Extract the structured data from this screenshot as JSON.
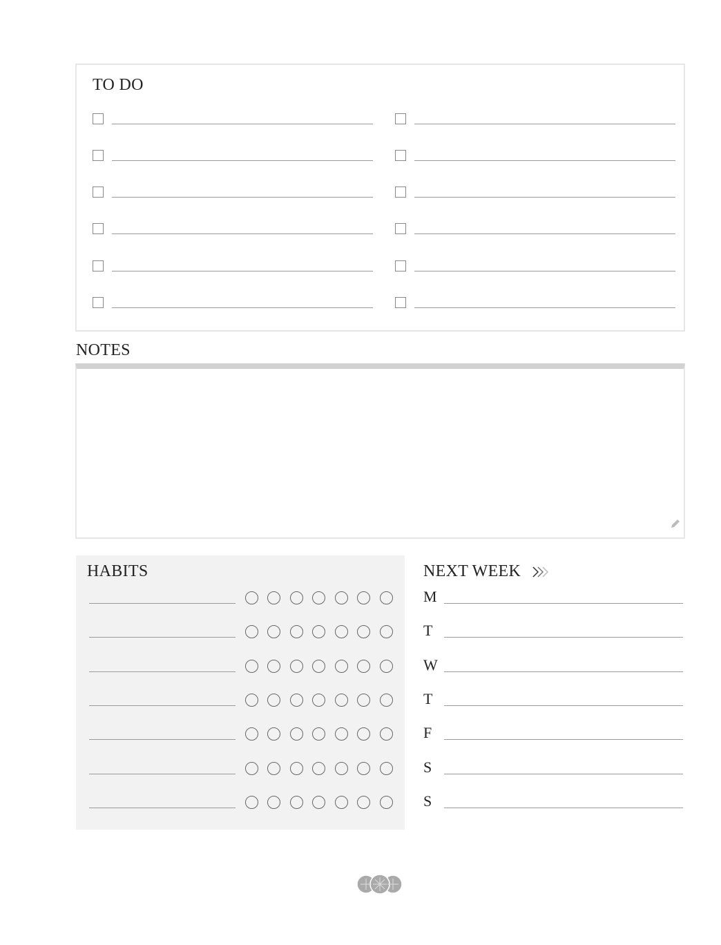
{
  "todo": {
    "title": "TO DO",
    "rows_per_column": 6,
    "columns": 2
  },
  "notes": {
    "title": "NOTES",
    "icon": "pencil-icon"
  },
  "habits": {
    "title": "HABITS",
    "rows": 7,
    "circles_per_row": 7
  },
  "next_week": {
    "title": "NEXT WEEK",
    "arrow": "»",
    "days": [
      "M",
      "T",
      "W",
      "T",
      "F",
      "S",
      "S"
    ]
  },
  "footer": {
    "logo": "three-compass-circles-logo"
  }
}
